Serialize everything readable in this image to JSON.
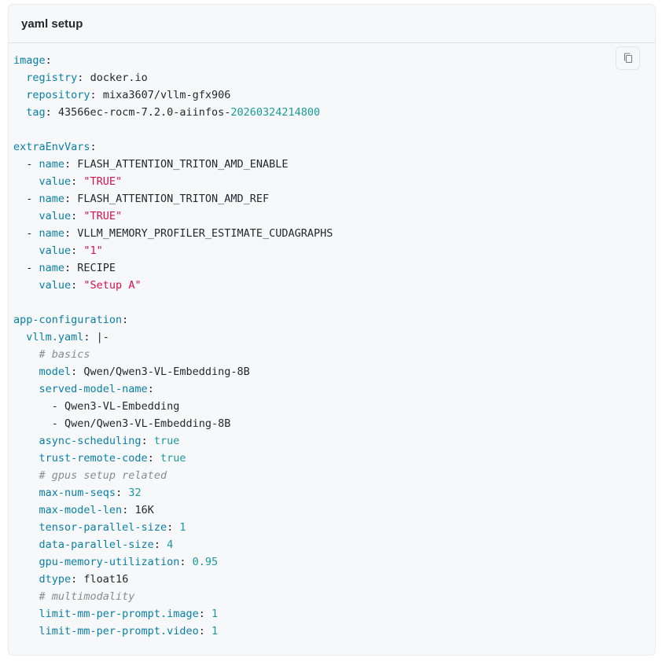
{
  "header": {
    "title": "yaml setup"
  },
  "code": {
    "lines": [
      [
        [
          "k",
          "image"
        ],
        [
          "p",
          ":"
        ]
      ],
      [
        [
          "p",
          "  "
        ],
        [
          "k",
          "registry"
        ],
        [
          "p",
          ": "
        ],
        [
          "v",
          "docker.io"
        ]
      ],
      [
        [
          "p",
          "  "
        ],
        [
          "k",
          "repository"
        ],
        [
          "p",
          ": "
        ],
        [
          "v",
          "mixa3607/vllm-gfx906"
        ]
      ],
      [
        [
          "p",
          "  "
        ],
        [
          "k",
          "tag"
        ],
        [
          "p",
          ": "
        ],
        [
          "v",
          "43566ec-rocm-7.2.0-aiinfos-"
        ],
        [
          "n",
          "20260324214800"
        ]
      ],
      [],
      [
        [
          "k",
          "extraEnvVars"
        ],
        [
          "p",
          ":"
        ]
      ],
      [
        [
          "p",
          "  - "
        ],
        [
          "k",
          "name"
        ],
        [
          "p",
          ": "
        ],
        [
          "v",
          "FLASH_ATTENTION_TRITON_AMD_ENABLE"
        ]
      ],
      [
        [
          "p",
          "    "
        ],
        [
          "k",
          "value"
        ],
        [
          "p",
          ": "
        ],
        [
          "s",
          "\"TRUE\""
        ]
      ],
      [
        [
          "p",
          "  - "
        ],
        [
          "k",
          "name"
        ],
        [
          "p",
          ": "
        ],
        [
          "v",
          "FLASH_ATTENTION_TRITON_AMD_REF"
        ]
      ],
      [
        [
          "p",
          "    "
        ],
        [
          "k",
          "value"
        ],
        [
          "p",
          ": "
        ],
        [
          "s",
          "\"TRUE\""
        ]
      ],
      [
        [
          "p",
          "  - "
        ],
        [
          "k",
          "name"
        ],
        [
          "p",
          ": "
        ],
        [
          "v",
          "VLLM_MEMORY_PROFILER_ESTIMATE_CUDAGRAPHS"
        ]
      ],
      [
        [
          "p",
          "    "
        ],
        [
          "k",
          "value"
        ],
        [
          "p",
          ": "
        ],
        [
          "s",
          "\"1\""
        ]
      ],
      [
        [
          "p",
          "  - "
        ],
        [
          "k",
          "name"
        ],
        [
          "p",
          ": "
        ],
        [
          "v",
          "RECIPE"
        ]
      ],
      [
        [
          "p",
          "    "
        ],
        [
          "k",
          "value"
        ],
        [
          "p",
          ": "
        ],
        [
          "s",
          "\"Setup A\""
        ]
      ],
      [],
      [
        [
          "k",
          "app-configuration"
        ],
        [
          "p",
          ":"
        ]
      ],
      [
        [
          "p",
          "  "
        ],
        [
          "k",
          "vllm.yaml"
        ],
        [
          "p",
          ": |-"
        ]
      ],
      [
        [
          "p",
          "    "
        ],
        [
          "c",
          "# basics"
        ]
      ],
      [
        [
          "p",
          "    "
        ],
        [
          "k",
          "model"
        ],
        [
          "p",
          ": "
        ],
        [
          "v",
          "Qwen/Qwen3-VL-Embedding-8B"
        ]
      ],
      [
        [
          "p",
          "    "
        ],
        [
          "k",
          "served-model-name"
        ],
        [
          "p",
          ":"
        ]
      ],
      [
        [
          "p",
          "      - "
        ],
        [
          "v",
          "Qwen3-VL-Embedding"
        ]
      ],
      [
        [
          "p",
          "      - "
        ],
        [
          "v",
          "Qwen/Qwen3-VL-Embedding-8B"
        ]
      ],
      [
        [
          "p",
          "    "
        ],
        [
          "k",
          "async-scheduling"
        ],
        [
          "p",
          ": "
        ],
        [
          "n",
          "true"
        ]
      ],
      [
        [
          "p",
          "    "
        ],
        [
          "k",
          "trust-remote-code"
        ],
        [
          "p",
          ": "
        ],
        [
          "n",
          "true"
        ]
      ],
      [
        [
          "p",
          "    "
        ],
        [
          "c",
          "# gpus setup related"
        ]
      ],
      [
        [
          "p",
          "    "
        ],
        [
          "k",
          "max-num-seqs"
        ],
        [
          "p",
          ": "
        ],
        [
          "n",
          "32"
        ]
      ],
      [
        [
          "p",
          "    "
        ],
        [
          "k",
          "max-model-len"
        ],
        [
          "p",
          ": "
        ],
        [
          "v",
          "16K"
        ]
      ],
      [
        [
          "p",
          "    "
        ],
        [
          "k",
          "tensor-parallel-size"
        ],
        [
          "p",
          ": "
        ],
        [
          "n",
          "1"
        ]
      ],
      [
        [
          "p",
          "    "
        ],
        [
          "k",
          "data-parallel-size"
        ],
        [
          "p",
          ": "
        ],
        [
          "n",
          "4"
        ]
      ],
      [
        [
          "p",
          "    "
        ],
        [
          "k",
          "gpu-memory-utilization"
        ],
        [
          "p",
          ": "
        ],
        [
          "n",
          "0.95"
        ]
      ],
      [
        [
          "p",
          "    "
        ],
        [
          "k",
          "dtype"
        ],
        [
          "p",
          ": "
        ],
        [
          "v",
          "float16"
        ]
      ],
      [
        [
          "p",
          "    "
        ],
        [
          "c",
          "# multimodality"
        ]
      ],
      [
        [
          "p",
          "    "
        ],
        [
          "k",
          "limit-mm-per-prompt.image"
        ],
        [
          "p",
          ": "
        ],
        [
          "n",
          "1"
        ]
      ],
      [
        [
          "p",
          "    "
        ],
        [
          "k",
          "limit-mm-per-prompt.video"
        ],
        [
          "p",
          ": "
        ],
        [
          "n",
          "1"
        ]
      ]
    ]
  },
  "copy_button": {
    "icon": "copy-icon"
  },
  "colors": {
    "key": "#0a7fa6",
    "string": "#d6124e",
    "number": "#1a9a9a",
    "comment": "#8b8b8b",
    "background": "#f6f8fa"
  }
}
